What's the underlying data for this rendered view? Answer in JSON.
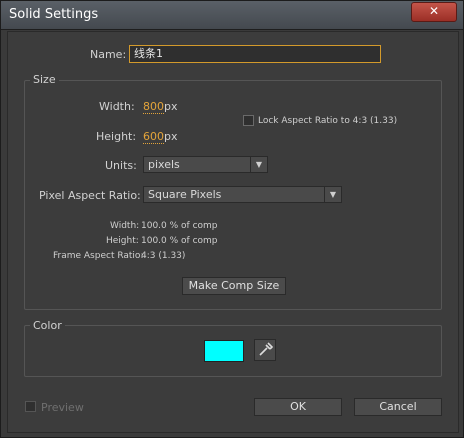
{
  "window": {
    "title": "Solid Settings",
    "close_label": "✕"
  },
  "name": {
    "label": "Name:",
    "value": "线条1"
  },
  "size_group": {
    "title": "Size",
    "width_label": "Width:",
    "width_value": "800",
    "width_unit": "px",
    "height_label": "Height:",
    "height_value": "600",
    "height_unit": "px",
    "lock_label": "Lock Aspect Ratio to 4:3 (1.33)",
    "units_label": "Units:",
    "units_value": "pixels",
    "par_label": "Pixel Aspect Ratio:",
    "par_value": "Square Pixels",
    "info": [
      {
        "label": "Width:",
        "value": "100.0 % of comp"
      },
      {
        "label": "Height:",
        "value": "100.0 % of comp"
      },
      {
        "label": "Frame Aspect Ratio:",
        "value": "4:3 (1.33)"
      }
    ],
    "make_comp_size": "Make Comp Size"
  },
  "color_group": {
    "title": "Color",
    "swatch_color": "#00ffff"
  },
  "footer": {
    "preview_label": "Preview",
    "ok_label": "OK",
    "cancel_label": "Cancel"
  }
}
